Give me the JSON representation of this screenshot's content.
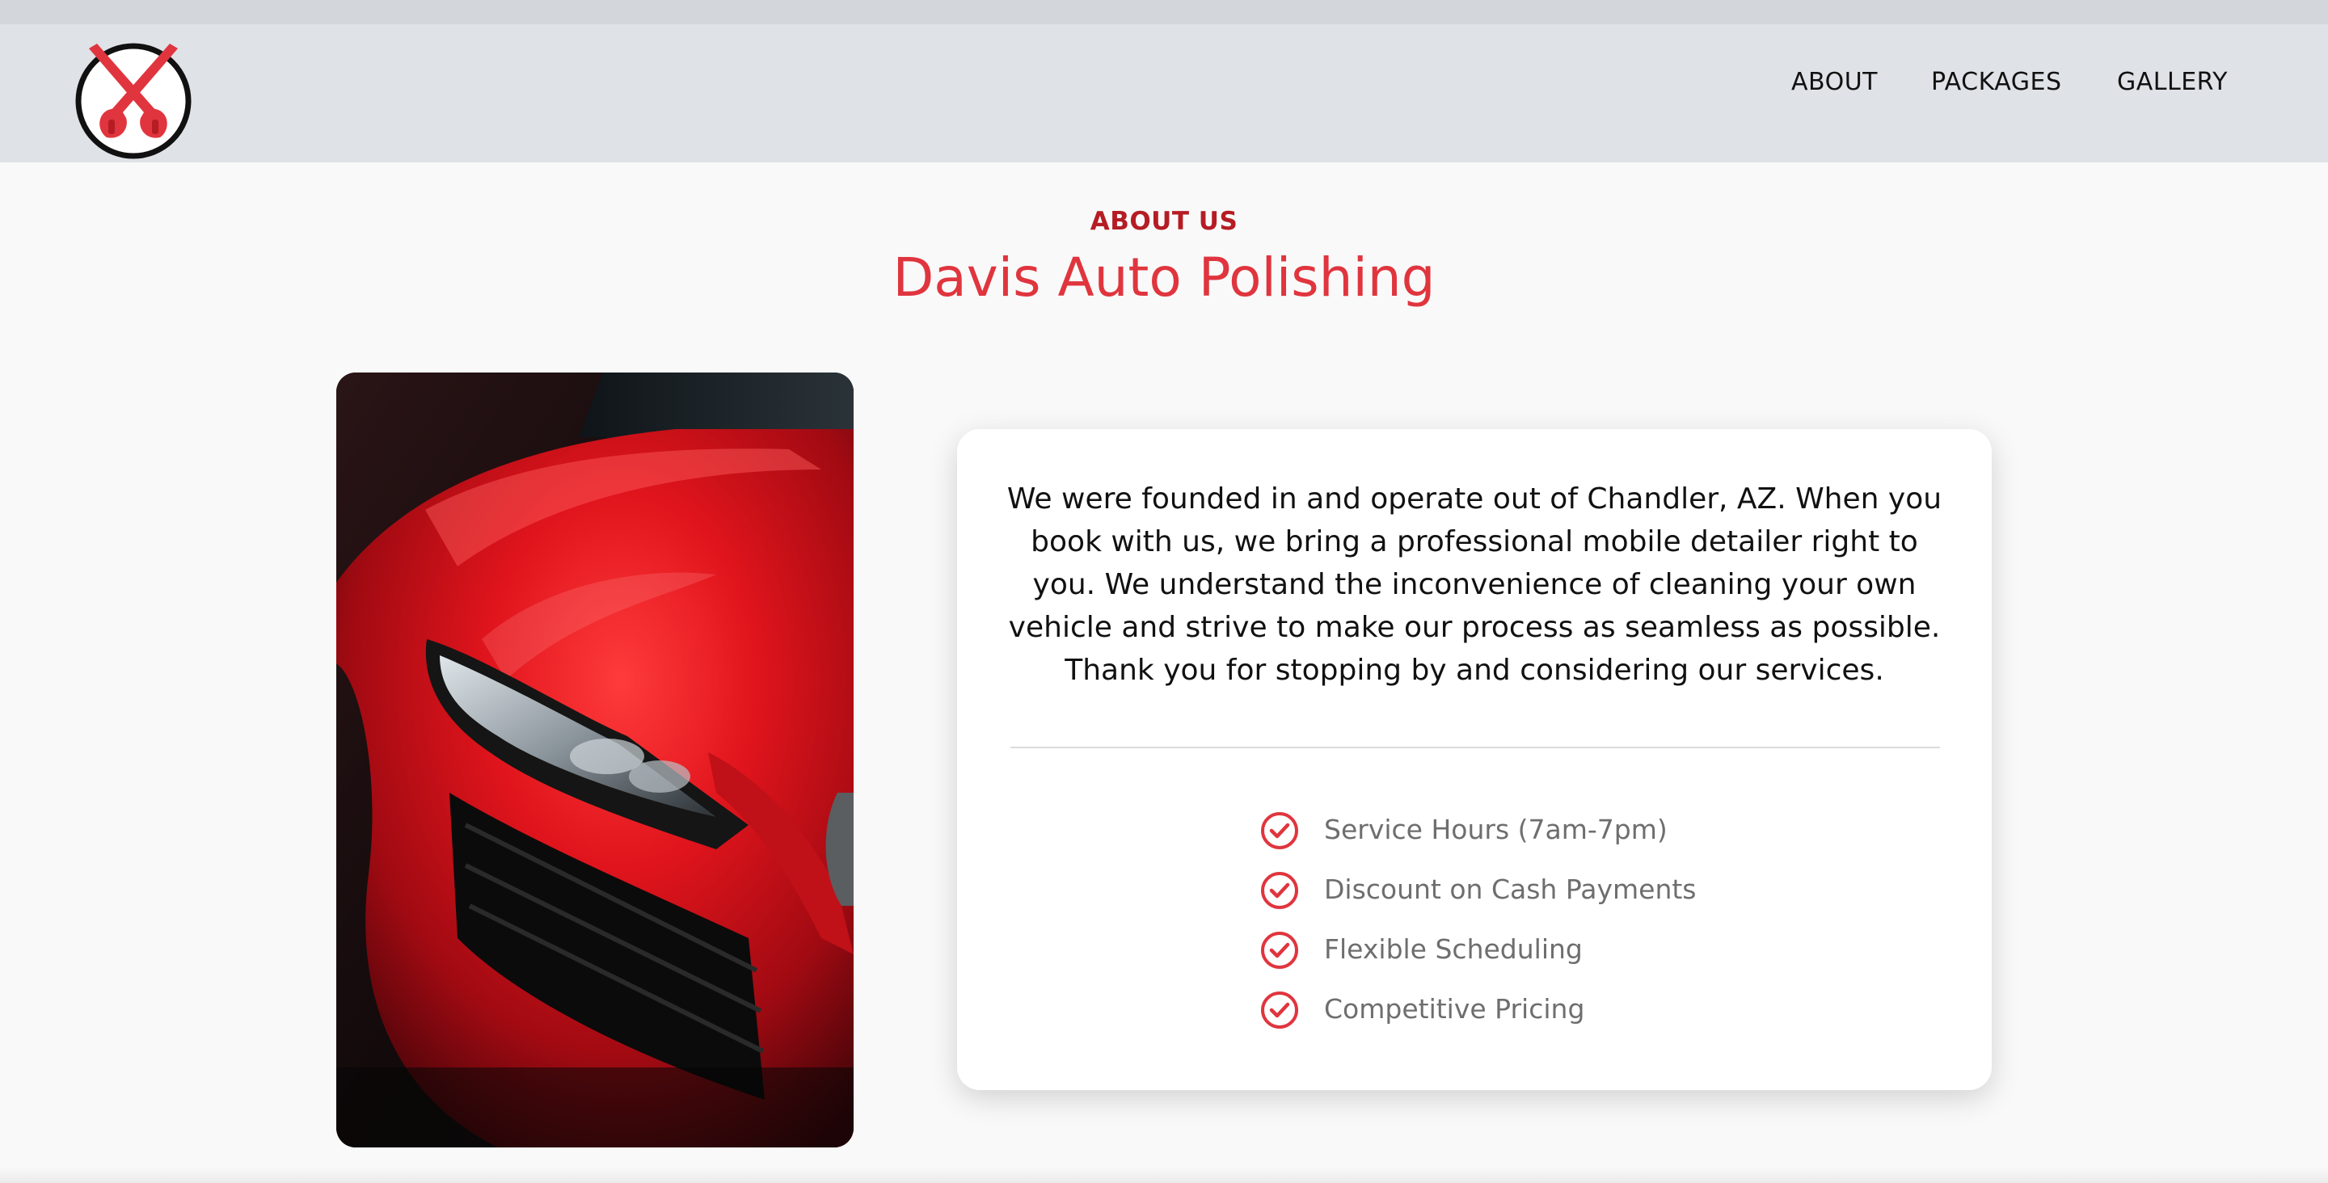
{
  "brand": {
    "logo_icon": "crossed-spray-guns-icon",
    "accent_color": "#e0353e",
    "dark_accent_color": "#b51c24"
  },
  "nav": {
    "items": [
      {
        "label": "ABOUT"
      },
      {
        "label": "PACKAGES"
      },
      {
        "label": "GALLERY"
      }
    ]
  },
  "about": {
    "eyebrow": "ABOUT US",
    "title": "Davis Auto Polishing",
    "description": "We were founded in and operate out of Chandler, AZ. When you book with us, we bring a professional mobile detailer right to you. We understand the inconvenience of cleaning your own vehicle and strive to make our process as seamless as possible. Thank you for stopping by and considering our services.",
    "features": [
      {
        "label": "Service Hours (7am-7pm)",
        "icon": "check-circle-icon"
      },
      {
        "label": "Discount on Cash Payments",
        "icon": "check-circle-icon"
      },
      {
        "label": "Flexible Scheduling",
        "icon": "check-circle-icon"
      },
      {
        "label": "Competitive Pricing",
        "icon": "check-circle-icon"
      }
    ]
  },
  "image": {
    "subject": "red-sports-car-headlight-photo"
  }
}
